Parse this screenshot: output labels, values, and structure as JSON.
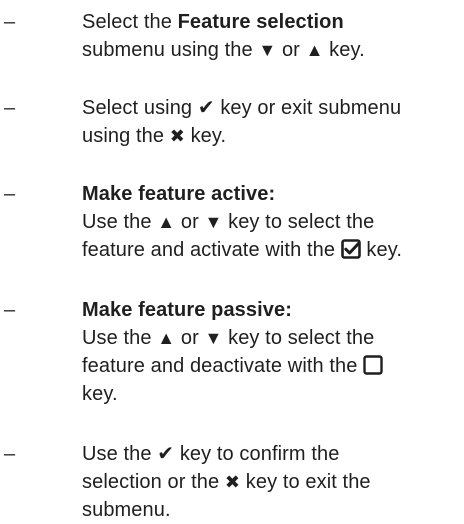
{
  "instructions": {
    "dash": "–",
    "step1": {
      "pre": "Select the ",
      "bold": "Feature selection",
      "line2_pre": "submenu using the ",
      "down": "▼",
      "or": " or ",
      "up": "▲",
      "end": " key."
    },
    "step2": {
      "pre": "Select using ",
      "check": "✔",
      "post": " key or exit submenu",
      "line2_pre": "using the ",
      "x": "✖",
      "end": " key."
    },
    "step3": {
      "heading": "Make feature active:",
      "line2_pre": "Use the ",
      "up": "▲",
      "or": " or ",
      "down": "▼",
      "line2_post": " key to select the",
      "line3_pre": "feature and activate with the ",
      "line3_end": " key."
    },
    "step4": {
      "heading": "Make feature passive:",
      "line2_pre": "Use the ",
      "up": "▲",
      "or": " or ",
      "down": "▼",
      "line2_post": " key to select the",
      "line3_pre": "feature and deactivate with the ",
      "line4": "key."
    },
    "step5": {
      "pre": "Use the ",
      "check": "✔",
      "post": " key to confirm the",
      "line2_pre": "selection or the ",
      "x": "✖",
      "line2_post": " key to exit the",
      "line3": "submenu."
    },
    "icons": {
      "checked_box": "checked-box-icon",
      "empty_box": "empty-box-icon",
      "check": "check-icon",
      "x": "x-icon"
    },
    "colors": {
      "text": "#1f1f1f",
      "icon": "#1f1f1f"
    }
  }
}
